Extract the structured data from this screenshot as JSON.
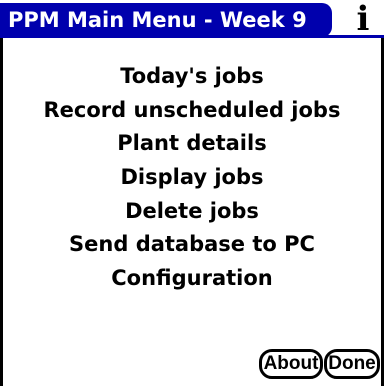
{
  "app": {
    "title": "PPM Main Menu - Week 9",
    "info_icon": "info-icon"
  },
  "menu": {
    "items": [
      {
        "label": "Today's jobs"
      },
      {
        "label": "Record unscheduled jobs"
      },
      {
        "label": "Plant details"
      },
      {
        "label": "Display jobs"
      },
      {
        "label": "Delete jobs"
      },
      {
        "label": "Send database to PC"
      },
      {
        "label": "Configuration"
      }
    ]
  },
  "buttons": {
    "about_label": "About",
    "done_label": "Done"
  },
  "colors": {
    "title_bar": "#0000ad",
    "title_text": "#ffffff",
    "text": "#000000",
    "background": "#ffffff"
  }
}
